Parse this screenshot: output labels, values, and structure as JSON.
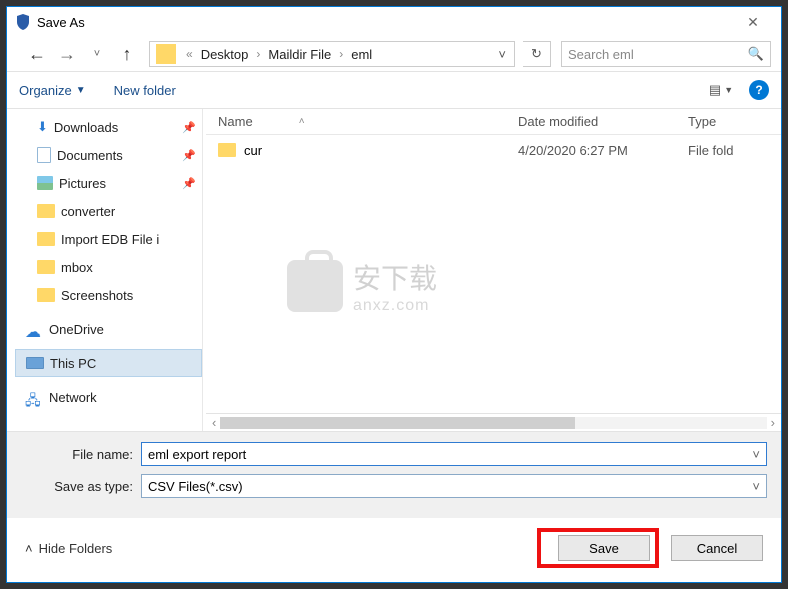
{
  "title": "Save As",
  "breadcrumb": {
    "prefix": "«",
    "p1": "Desktop",
    "p2": "Maildir File",
    "p3": "eml"
  },
  "search": {
    "placeholder": "Search eml"
  },
  "toolbar": {
    "organize": "Organize",
    "newfolder": "New folder"
  },
  "tree": {
    "downloads": "Downloads",
    "documents": "Documents",
    "pictures": "Pictures",
    "converter": "converter",
    "importedb": "Import EDB File i",
    "mbox": "mbox",
    "screenshots": "Screenshots",
    "onedrive": "OneDrive",
    "thispc": "This PC",
    "network": "Network"
  },
  "columns": {
    "name": "Name",
    "date": "Date modified",
    "type": "Type"
  },
  "rows": [
    {
      "name": "cur",
      "date": "4/20/2020 6:27 PM",
      "type": "File fold"
    }
  ],
  "watermark": {
    "line1": "安下载",
    "line2": "anxz.com"
  },
  "form": {
    "filename_label": "File name:",
    "filename_value": "eml export report",
    "saveastype_label": "Save as type:",
    "saveastype_value": "CSV Files(*.csv)"
  },
  "footer": {
    "hide": "Hide Folders",
    "save": "Save",
    "cancel": "Cancel"
  }
}
